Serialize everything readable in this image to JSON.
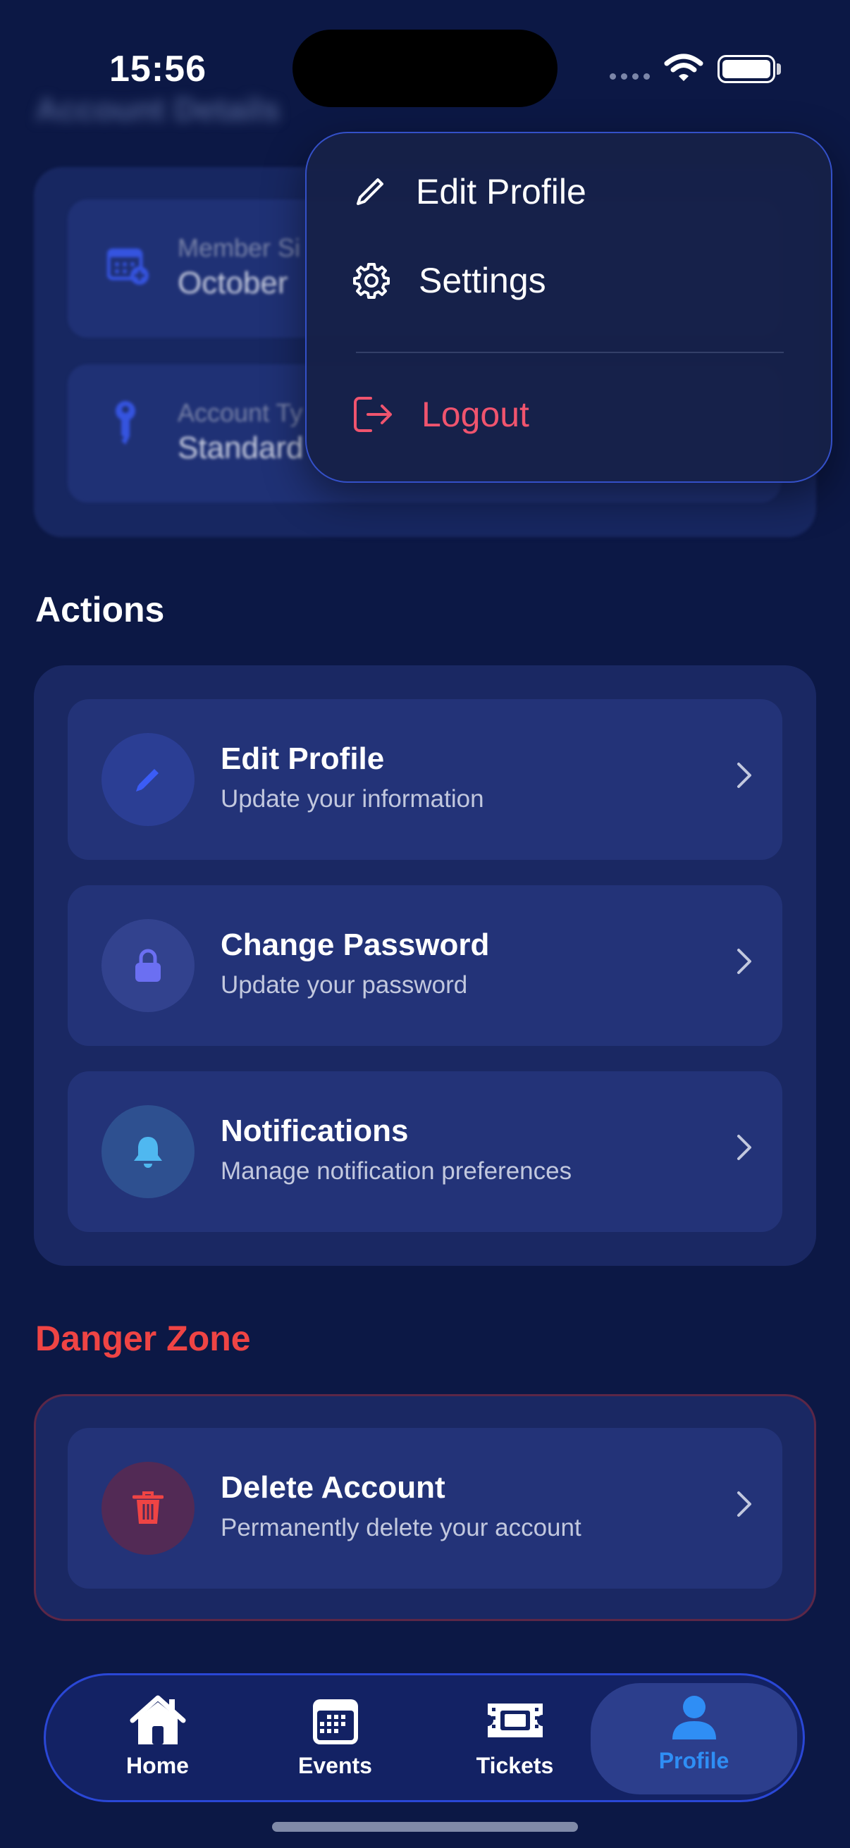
{
  "status_bar": {
    "time": "15:56"
  },
  "account_details": {
    "title": "Account Details",
    "member_since_label": "Member Si",
    "member_since_value": "October",
    "account_type_label": "Account Ty",
    "account_type_value": "Standard"
  },
  "menu": {
    "items": [
      {
        "label": "Edit Profile",
        "icon": "pencil-icon"
      },
      {
        "label": "Settings",
        "icon": "gear-icon"
      },
      {
        "label": "Logout",
        "icon": "logout-icon",
        "color": "#f0546e"
      }
    ]
  },
  "actions": {
    "title": "Actions",
    "rows": [
      {
        "title": "Edit Profile",
        "subtitle": "Update your information",
        "icon": "pencil-icon"
      },
      {
        "title": "Change Password",
        "subtitle": "Update your password",
        "icon": "lock-icon"
      },
      {
        "title": "Notifications",
        "subtitle": "Manage notification preferences",
        "icon": "bell-icon"
      }
    ]
  },
  "danger_zone": {
    "title": "Danger Zone",
    "rows": [
      {
        "title": "Delete Account",
        "subtitle": "Permanently delete your account",
        "icon": "trash-icon"
      }
    ]
  },
  "tabbar": {
    "tabs": [
      {
        "label": "Home",
        "icon": "house-icon"
      },
      {
        "label": "Events",
        "icon": "calendar-icon"
      },
      {
        "label": "Tickets",
        "icon": "ticket-icon"
      },
      {
        "label": "Profile",
        "icon": "person-icon",
        "active": true
      }
    ]
  },
  "colors": {
    "background": "#0c1845",
    "accent": "#2f8ef5",
    "danger": "#ef4444",
    "logout": "#f0546e"
  }
}
